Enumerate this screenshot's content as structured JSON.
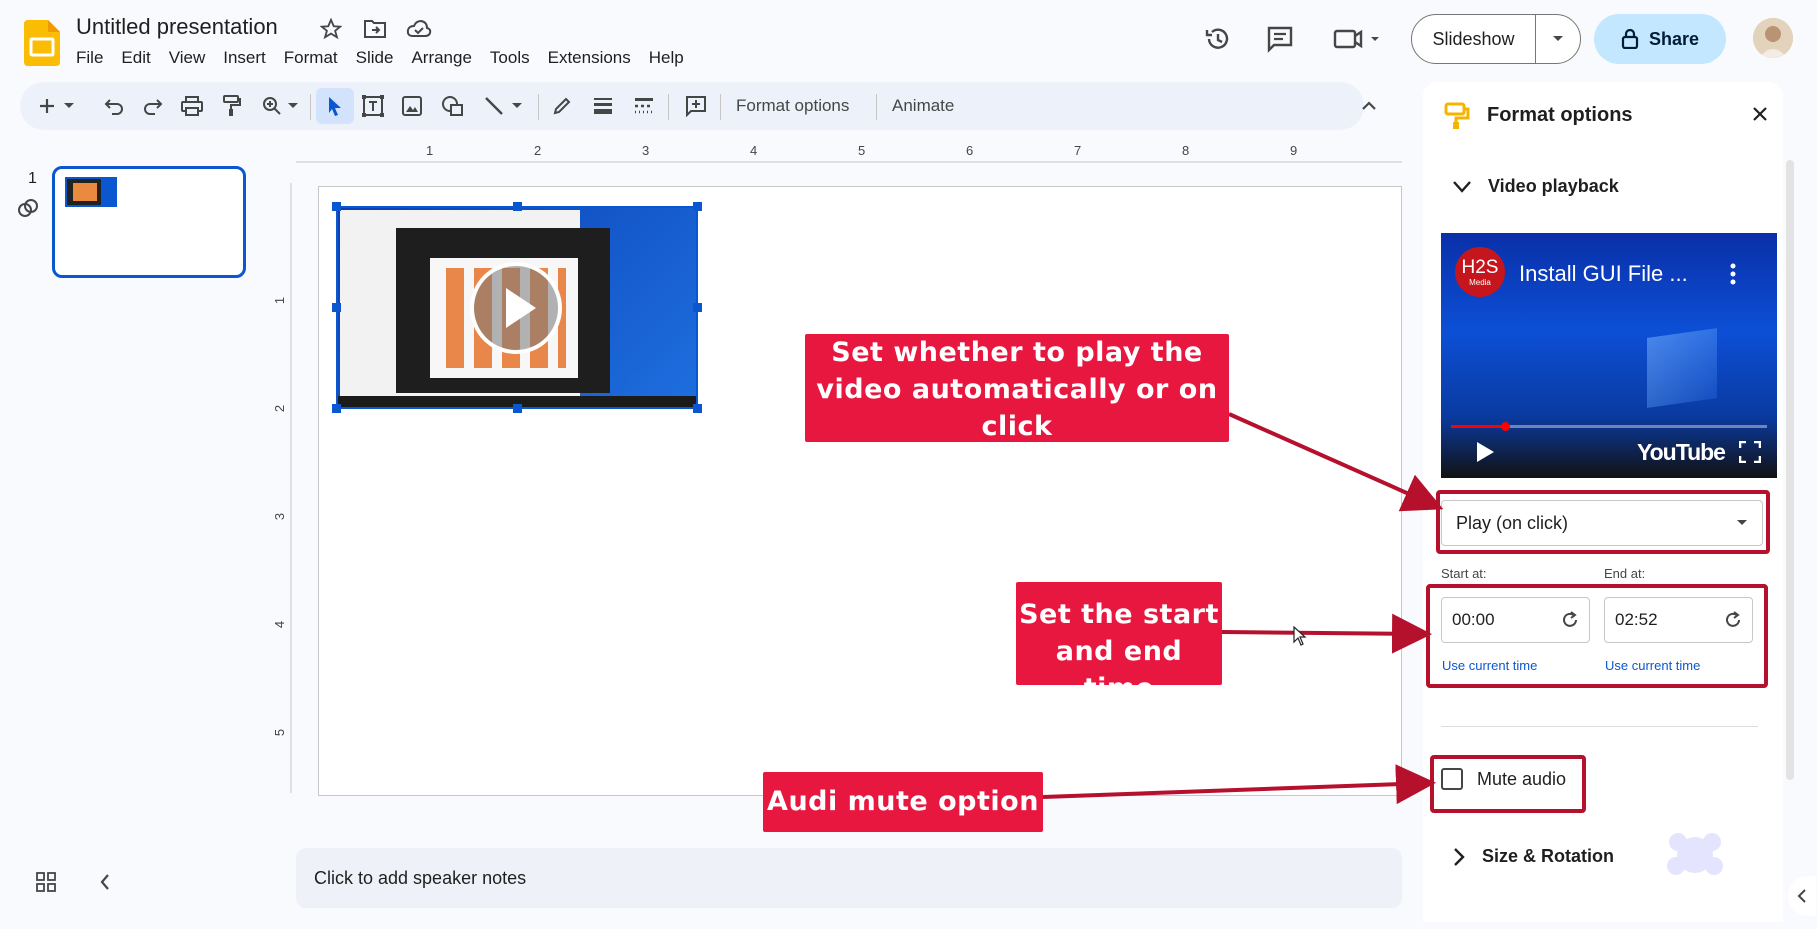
{
  "header": {
    "title": "Untitled presentation",
    "menu": [
      "File",
      "Edit",
      "View",
      "Insert",
      "Format",
      "Slide",
      "Arrange",
      "Tools",
      "Extensions",
      "Help"
    ],
    "slideshow_label": "Slideshow",
    "share_label": "Share"
  },
  "toolbar": {
    "format_options_label": "Format options",
    "animate_label": "Animate"
  },
  "filmstrip": {
    "slide_number": "1"
  },
  "ruler": {
    "top_ticks": [
      "1",
      "2",
      "3",
      "4",
      "5",
      "6",
      "7",
      "8",
      "9"
    ],
    "left_ticks": [
      "1",
      "2",
      "3",
      "4",
      "5"
    ]
  },
  "notes": {
    "placeholder": "Click to add speaker notes"
  },
  "panel": {
    "title": "Format options",
    "video_section": "Video playback",
    "video_title": "Install GUI File ...",
    "channel_badge": "H2S",
    "channel_badge_sub": "Media",
    "youtube_label": "YouTube",
    "playback_mode": "Play (on click)",
    "start_label": "Start at:",
    "end_label": "End at:",
    "start_time": "00:00",
    "end_time": "02:52",
    "use_current_time": "Use current time",
    "mute_label": "Mute audio",
    "size_section": "Size & Rotation"
  },
  "annotations": {
    "callout_playback": "Set whether to play the video automatically or on click",
    "callout_time": "Set the start and end time",
    "callout_mute": "Audi mute option"
  },
  "colors": {
    "accent": "#0b57d0",
    "callout": "#e8173f",
    "highlight_border": "#b5102c",
    "share_bg": "#c2e7ff"
  }
}
